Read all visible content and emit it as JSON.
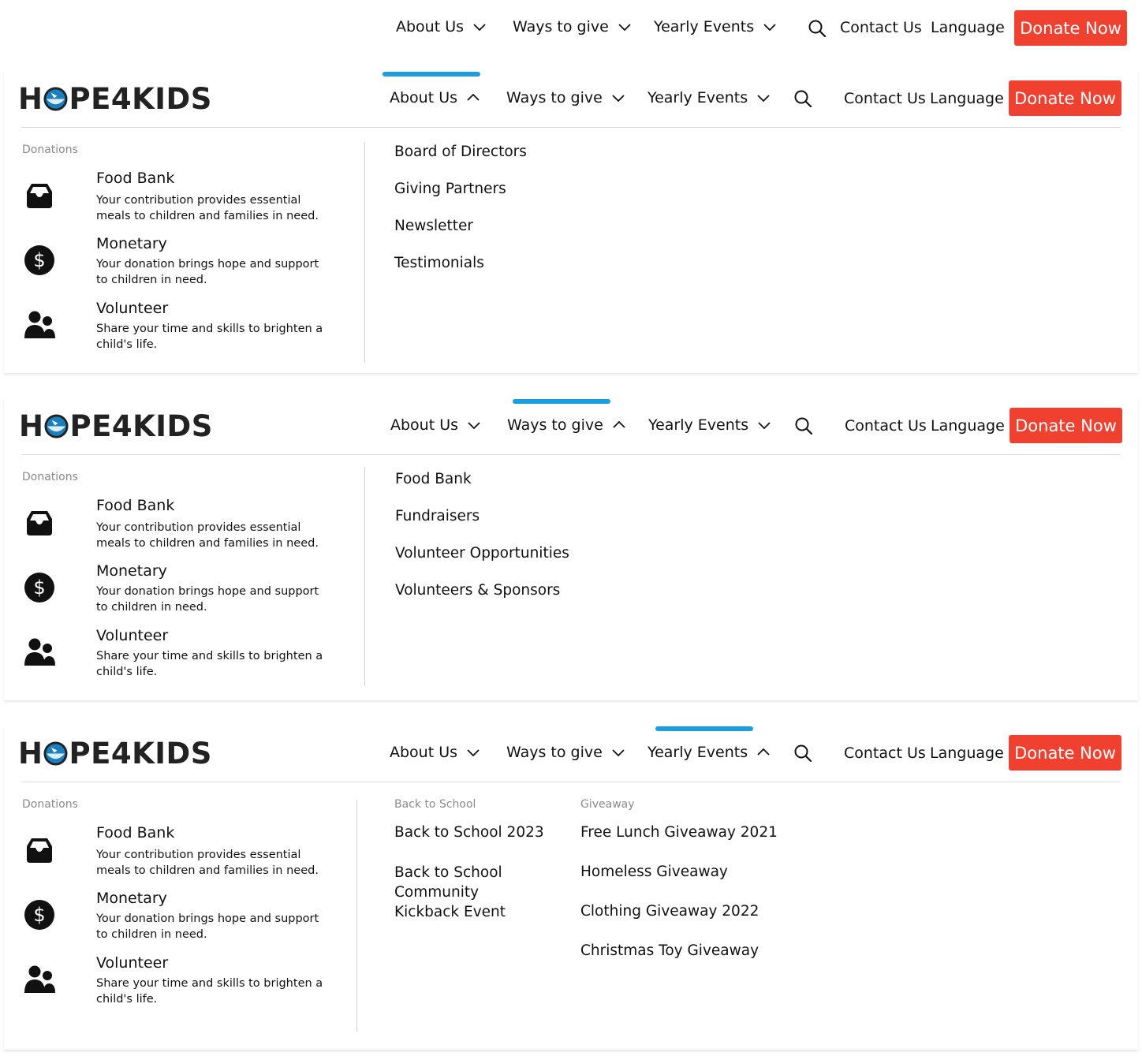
{
  "brand": {
    "logo_left": "H",
    "logo_right": "PE4KIDS"
  },
  "nav": {
    "about": "About Us",
    "ways": "Ways to give",
    "events": "Yearly Events",
    "contact": "Contact Us",
    "language": "Language",
    "donate": "Donate Now"
  },
  "colors": {
    "accent": "#1a9ee0",
    "donate": "#f0402f"
  },
  "donations": {
    "heading": "Donations",
    "items": [
      {
        "title": "Food Bank",
        "desc": "Your contribution provides essential meals to children and families in need.",
        "icon": "inbox-tray-icon"
      },
      {
        "title": "Monetary",
        "desc": "Your donation brings hope and support to children in need.",
        "icon": "dollar-circle-icon"
      },
      {
        "title": "Volunteer",
        "desc": "Share your time and skills to brighten a child's life.",
        "icon": "users-icon"
      }
    ]
  },
  "about_menu": [
    "Board of Directors",
    "Giving Partners",
    "Newsletter",
    "Testimonials"
  ],
  "ways_menu": [
    "Food Bank",
    "Fundraisers",
    "Volunteer Opportunities",
    "Volunteers & Sponsors"
  ],
  "events_menu": {
    "back_to_school": {
      "heading": "Back to School",
      "items": [
        "Back to School 2023",
        "Back to School Community Kickback Event"
      ]
    },
    "giveaway": {
      "heading": "Giveaway",
      "items": [
        "Free Lunch Giveaway 2021",
        "Homeless Giveaway",
        "Clothing Giveaway 2022",
        "Christmas Toy Giveaway"
      ]
    }
  }
}
